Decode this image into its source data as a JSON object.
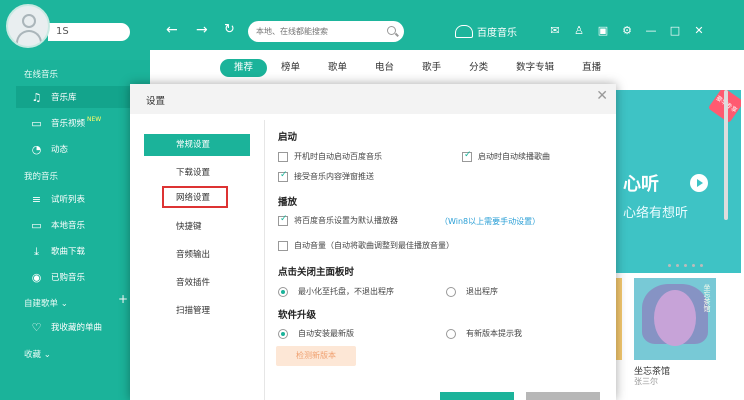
{
  "header": {
    "username": "1S",
    "search_placeholder": "本地、在线都能搜索",
    "brand": "百度音乐"
  },
  "sidebar": {
    "section_online": "在线音乐",
    "items_online": [
      {
        "label": "音乐库",
        "icon": "music-note-icon"
      },
      {
        "label": "音乐视频",
        "icon": "tv-icon",
        "badge": "NEW"
      },
      {
        "label": "动态",
        "icon": "activity-icon"
      }
    ],
    "section_mine": "我的音乐",
    "items_mine": [
      {
        "label": "试听列表",
        "icon": "playlist-icon"
      },
      {
        "label": "本地音乐",
        "icon": "computer-icon"
      },
      {
        "label": "歌曲下载",
        "icon": "download-icon"
      },
      {
        "label": "已购音乐",
        "icon": "purchased-icon"
      }
    ],
    "section_custom": "自建歌单",
    "item_fav": "我收藏的单曲",
    "section_collect": "收藏"
  },
  "main": {
    "tabs": [
      "推荐",
      "榜单",
      "歌单",
      "电台",
      "歌手",
      "分类",
      "数字专辑",
      "直播"
    ],
    "banner_text1": "心听",
    "banner_text2": "心络有想听",
    "banner_sticker": "豪华专享",
    "album_title": "坐忘茶馆",
    "album_artist": "张三尔",
    "album_cover_text": "坐忘茶馆"
  },
  "dialog": {
    "title": "设置",
    "nav": [
      "常规设置",
      "下载设置",
      "网络设置",
      "快捷键",
      "音频输出",
      "音效插件",
      "扫描管理"
    ],
    "sections": {
      "startup": "启动",
      "play": "播放",
      "close": "点击关闭主面板时",
      "upgrade": "软件升级"
    },
    "options": {
      "auto_start": "开机时自动启动百度音乐",
      "auto_resume": "启动时自动续播歌曲",
      "accept_push": "接受音乐内容弹窗推送",
      "default_player": "将百度音乐设置为默认播放器",
      "win8_link": "（Win8以上需要手动设置）",
      "auto_volume": "自动音量（自动将歌曲调整到最佳播放音量）",
      "minimize_tray": "最小化至托盘，不退出程序",
      "exit_program": "退出程序",
      "auto_install": "自动安装最新版",
      "notify_new": "有新版本提示我",
      "check_update": "检测新版本"
    }
  }
}
